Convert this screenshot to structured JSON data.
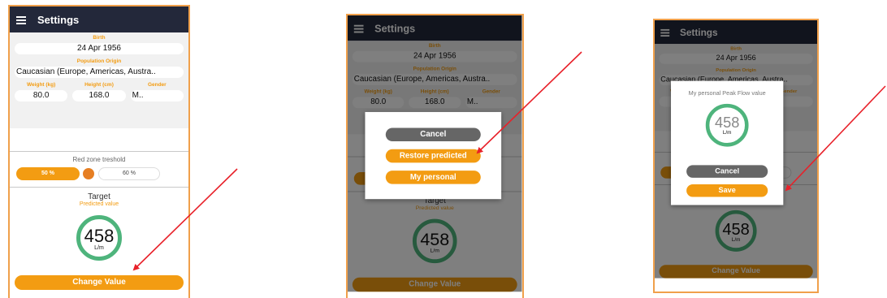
{
  "settings": {
    "app_title": "Settings",
    "birth_label": "Birth",
    "birth_value": "24 Apr 1956",
    "origin_label": "Population Origin",
    "origin_value": "Caucasian (Europe, Americas, Austra..",
    "weight_label": "Weight (kg)",
    "weight_value": "80.0",
    "height_label": "Height (cm)",
    "height_value": "168.0",
    "gender_label": "Gender",
    "gender_value": "M..",
    "red_zone_label": "Red zone treshold",
    "red_zone_min": "50 %",
    "red_zone_max": "60 %",
    "target_title": "Target",
    "target_subtitle": "Predicted value",
    "peak_flow_value": "458",
    "peak_flow_unit": "L/m",
    "change_button": "Change Value"
  },
  "dialog_options": {
    "cancel": "Cancel",
    "restore": "Restore predicted",
    "personal": "My personal"
  },
  "dialog_personal": {
    "title": "My personal Peak Flow value",
    "value": "458",
    "unit": "L/m",
    "cancel": "Cancel",
    "save": "Save"
  },
  "colors": {
    "accent": "#f39c12",
    "ring": "#4eb47c",
    "appbar": "#23283a",
    "arrow": "#e8212a",
    "frame": "#f0a04b"
  },
  "icons": [
    "menu-icon"
  ]
}
